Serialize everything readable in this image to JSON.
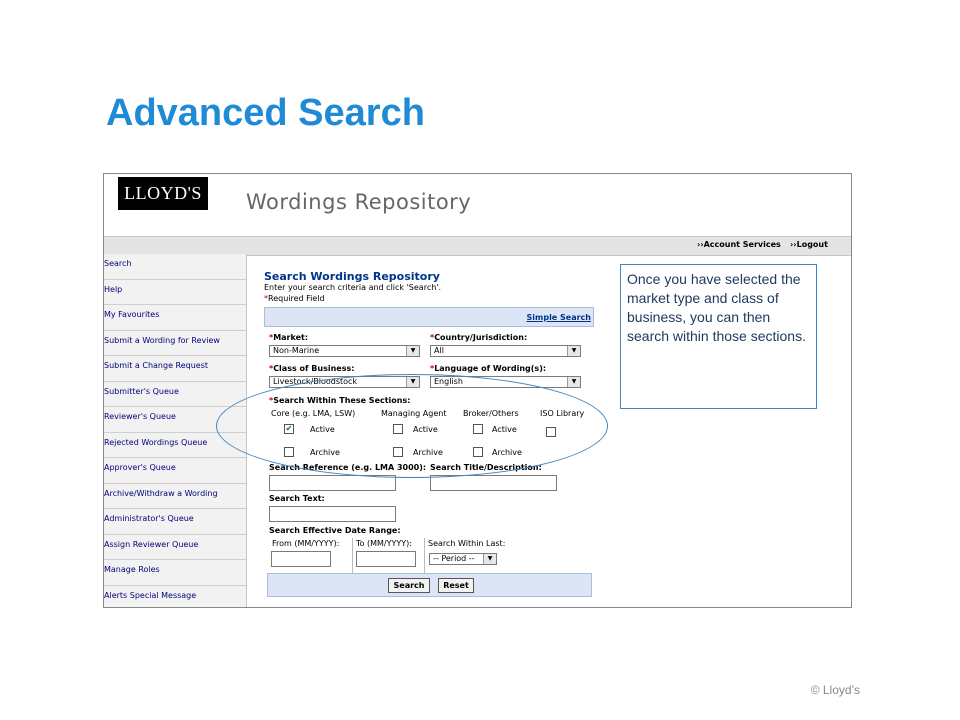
{
  "slide": {
    "title": "Advanced Search",
    "copyright": "© Lloyd’s"
  },
  "header": {
    "logo_text": "LLOYD'S",
    "app_title": "Wordings Repository"
  },
  "topbar": {
    "account_services": "››Account Services",
    "logout": "››Logout"
  },
  "sidebar": {
    "items": [
      "Search",
      "Help",
      "My Favourites",
      "Submit a Wording for Review",
      "Submit a Change Request",
      "Submitter's Queue",
      "Reviewer's Queue",
      "Rejected Wordings Queue",
      "Approver's Queue",
      "Archive/Withdraw a Wording",
      "Administrator's Queue",
      "Assign Reviewer Queue",
      "Manage Roles",
      "Alerts Special Message"
    ]
  },
  "form": {
    "title": "Search Wordings Repository",
    "subtitle": "Enter your search criteria and click 'Search'.",
    "required_star": "*",
    "required_note": "Required Field",
    "simple_search": "Simple Search",
    "market_label": "Market:",
    "market_value": "Non-Marine",
    "country_label": "Country/Jurisdiction:",
    "country_value": "All",
    "class_label": "Class of Business:",
    "class_value": "Livestock/Bloodstock",
    "language_label": "Language of Wording(s):",
    "language_value": "English",
    "sections_label": "Search Within These Sections:",
    "section_headers": [
      "Core (e.g. LMA, LSW)",
      "Managing Agent",
      "Broker/Others",
      "ISO Library"
    ],
    "active_label": "Active",
    "archive_label": "Archive",
    "core_active_checked": true,
    "search_reference_label": "Search Reference (e.g. LMA 3000):",
    "search_title_label": "Search Title/Description:",
    "search_text_label": "Search Text:",
    "date_range_label": "Search Effective Date Range:",
    "from_label": "From (MM/YYYY):",
    "to_label": "To (MM/YYYY):",
    "within_last_label": "Search Within Last:",
    "period_value": "-- Period --",
    "search_button": "Search",
    "reset_button": "Reset"
  },
  "callout": {
    "text": "Once you have selected the market type and class of business, you can then search within those sections."
  },
  "colors": {
    "title": "#1f8bd6",
    "link": "#00338a",
    "sidebar_link": "#00007a",
    "required": "#c00000",
    "bar": "#dbe5f6",
    "ellipse": "#3f86c2"
  },
  "icons": {
    "dropdown": "chevron-down-icon",
    "checkmark": "checkmark-icon"
  }
}
